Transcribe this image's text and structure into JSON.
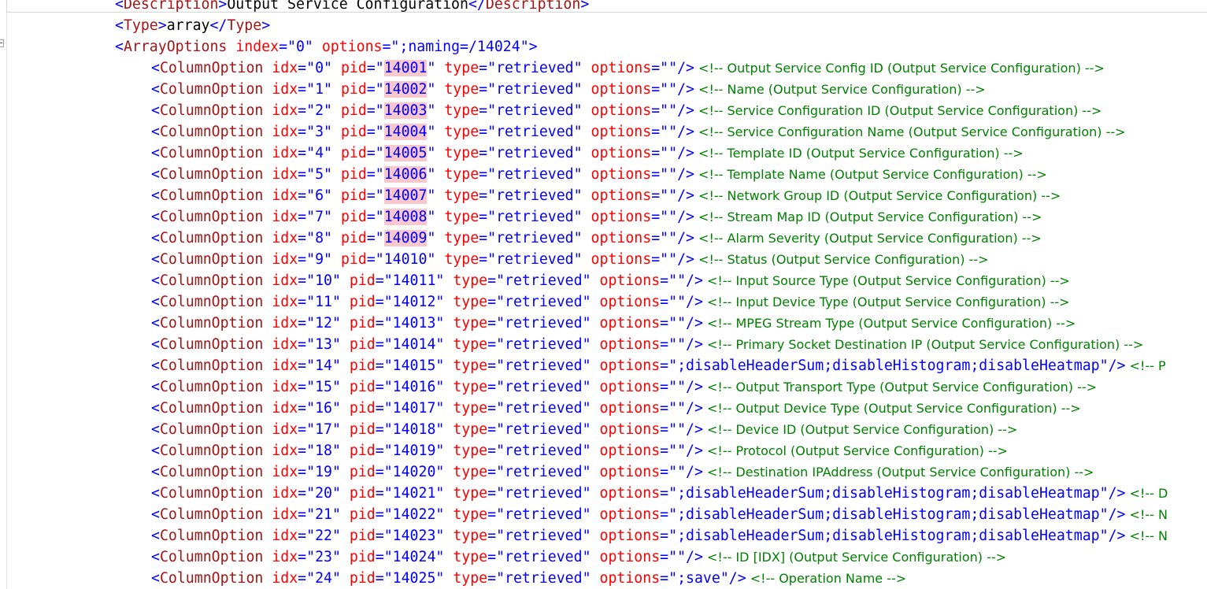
{
  "editor": {
    "colors": {
      "tag": "#a31515",
      "attribute": "#ff0000",
      "value": "#0000ff",
      "comment": "#008000",
      "highlight": "#f8c8cc"
    },
    "header_lines": [
      {
        "kind": "text-element",
        "tag": "Description",
        "content": "Output Service Configuration"
      },
      {
        "kind": "text-element",
        "tag": "Type",
        "content": "array"
      },
      {
        "kind": "open-element",
        "tag": "ArrayOptions",
        "attrs": [
          {
            "name": "index",
            "value": "0"
          },
          {
            "name": "options",
            "value": ";naming=/14024"
          }
        ]
      }
    ],
    "column_tag": "ColumnOption",
    "rows": [
      {
        "idx": "0",
        "pid": "14001",
        "type": "retrieved",
        "options": "",
        "comment": "<!-- Output Service Config ID (Output Service Configuration) -->",
        "pid_highlight": true
      },
      {
        "idx": "1",
        "pid": "14002",
        "type": "retrieved",
        "options": "",
        "comment": "<!-- Name (Output Service Configuration) -->",
        "pid_highlight": true
      },
      {
        "idx": "2",
        "pid": "14003",
        "type": "retrieved",
        "options": "",
        "comment": "<!-- Service Configuration ID (Output Service Configuration) -->",
        "pid_highlight": true
      },
      {
        "idx": "3",
        "pid": "14004",
        "type": "retrieved",
        "options": "",
        "comment": "<!-- Service Configuration Name (Output Service Configuration) -->",
        "pid_highlight": true
      },
      {
        "idx": "4",
        "pid": "14005",
        "type": "retrieved",
        "options": "",
        "comment": "<!-- Template ID (Output Service Configuration) -->",
        "pid_highlight": true
      },
      {
        "idx": "5",
        "pid": "14006",
        "type": "retrieved",
        "options": "",
        "comment": "<!-- Template Name (Output Service Configuration) -->",
        "pid_highlight": true
      },
      {
        "idx": "6",
        "pid": "14007",
        "type": "retrieved",
        "options": "",
        "comment": "<!-- Network Group ID (Output Service Configuration) -->",
        "pid_highlight": true
      },
      {
        "idx": "7",
        "pid": "14008",
        "type": "retrieved",
        "options": "",
        "comment": "<!-- Stream Map ID (Output Service Configuration) -->",
        "pid_highlight": true
      },
      {
        "idx": "8",
        "pid": "14009",
        "type": "retrieved",
        "options": "",
        "comment": "<!-- Alarm Severity (Output Service Configuration) -->",
        "pid_highlight": true
      },
      {
        "idx": "9",
        "pid": "14010",
        "type": "retrieved",
        "options": "",
        "comment": "<!-- Status (Output Service Configuration) -->",
        "pid_highlight": false
      },
      {
        "idx": "10",
        "pid": "14011",
        "type": "retrieved",
        "options": "",
        "comment": "<!-- Input Source Type (Output Service Configuration) -->",
        "pid_highlight": false
      },
      {
        "idx": "11",
        "pid": "14012",
        "type": "retrieved",
        "options": "",
        "comment": "<!-- Input Device Type (Output Service Configuration) -->",
        "pid_highlight": false
      },
      {
        "idx": "12",
        "pid": "14013",
        "type": "retrieved",
        "options": "",
        "comment": "<!-- MPEG Stream Type (Output Service Configuration) -->",
        "pid_highlight": false
      },
      {
        "idx": "13",
        "pid": "14014",
        "type": "retrieved",
        "options": "",
        "comment": "<!-- Primary Socket Destination IP (Output Service Configuration) -->",
        "pid_highlight": false
      },
      {
        "idx": "14",
        "pid": "14015",
        "type": "retrieved",
        "options": ";disableHeaderSum;disableHistogram;disableHeatmap",
        "comment": "<!-- P",
        "pid_highlight": false
      },
      {
        "idx": "15",
        "pid": "14016",
        "type": "retrieved",
        "options": "",
        "comment": "<!-- Output Transport Type (Output Service Configuration) -->",
        "pid_highlight": false
      },
      {
        "idx": "16",
        "pid": "14017",
        "type": "retrieved",
        "options": "",
        "comment": "<!-- Output Device Type (Output Service Configuration) -->",
        "pid_highlight": false
      },
      {
        "idx": "17",
        "pid": "14018",
        "type": "retrieved",
        "options": "",
        "comment": "<!-- Device ID (Output Service Configuration) -->",
        "pid_highlight": false
      },
      {
        "idx": "18",
        "pid": "14019",
        "type": "retrieved",
        "options": "",
        "comment": "<!-- Protocol (Output Service Configuration) -->",
        "pid_highlight": false
      },
      {
        "idx": "19",
        "pid": "14020",
        "type": "retrieved",
        "options": "",
        "comment": "<!-- Destination IPAddress (Output Service Configuration) -->",
        "pid_highlight": false
      },
      {
        "idx": "20",
        "pid": "14021",
        "type": "retrieved",
        "options": ";disableHeaderSum;disableHistogram;disableHeatmap",
        "comment": "<!-- D",
        "pid_highlight": false
      },
      {
        "idx": "21",
        "pid": "14022",
        "type": "retrieved",
        "options": ";disableHeaderSum;disableHistogram;disableHeatmap",
        "comment": "<!-- N",
        "pid_highlight": false
      },
      {
        "idx": "22",
        "pid": "14023",
        "type": "retrieved",
        "options": ";disableHeaderSum;disableHistogram;disableHeatmap",
        "comment": "<!-- N",
        "pid_highlight": false
      },
      {
        "idx": "23",
        "pid": "14024",
        "type": "retrieved",
        "options": "",
        "comment": "<!-- ID [IDX] (Output Service Configuration) -->",
        "pid_highlight": false
      },
      {
        "idx": "24",
        "pid": "14025",
        "type": "retrieved",
        "options": ";save",
        "comment": "<!-- Operation Name -->",
        "pid_highlight": false
      }
    ]
  }
}
